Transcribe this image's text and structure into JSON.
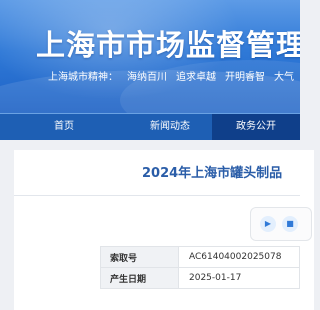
{
  "banner": {
    "title": "上海市市场监督管理",
    "spirit": [
      "上海城市精神：",
      "海纳百川",
      "追求卓越",
      "开明睿智",
      "大气"
    ]
  },
  "nav": {
    "items": [
      {
        "label": "首页",
        "active": false
      },
      {
        "label": "新闻动态",
        "active": false
      },
      {
        "label": "政务公开",
        "active": true
      }
    ]
  },
  "article": {
    "title": "2024年上海市罐头制品",
    "meta": [
      {
        "key": "索取号",
        "value": "AC61404002025078"
      },
      {
        "key": "产生日期",
        "value": "2025-01-17"
      }
    ]
  },
  "player": {
    "play_icon": "play-icon",
    "stop_icon": "stop-icon"
  },
  "colors": {
    "banner": "#2f79d7",
    "nav": "#1e5fb4",
    "nav_active": "#0f3f8a",
    "title": "#2a5da8"
  }
}
